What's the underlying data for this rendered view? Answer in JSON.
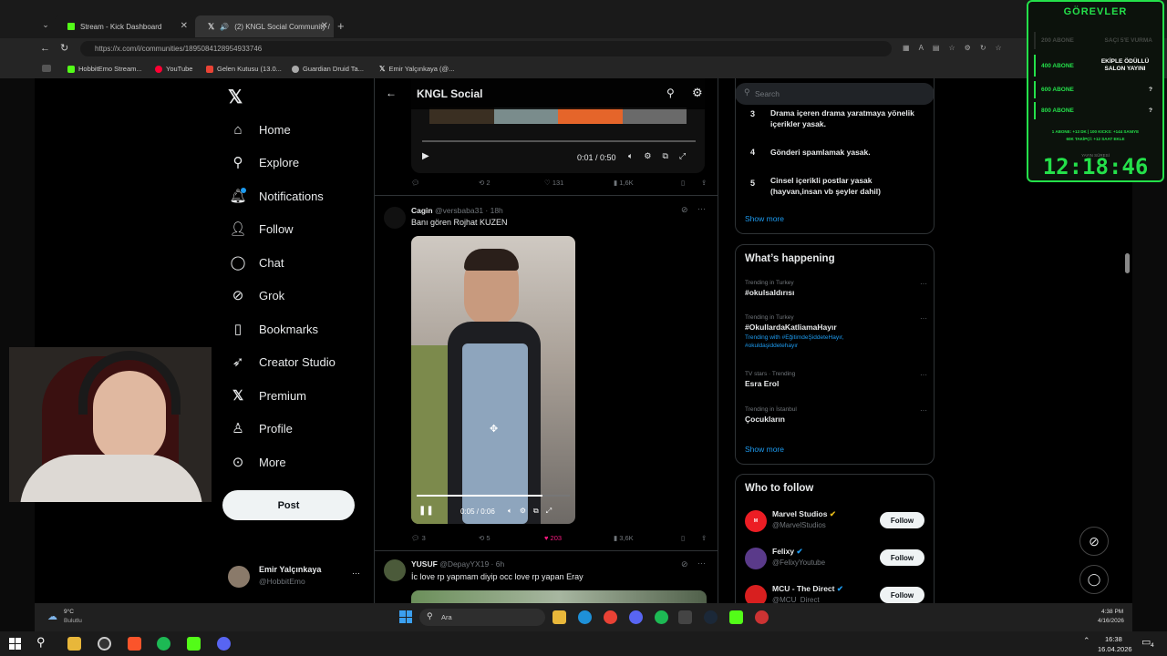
{
  "tabs": [
    {
      "label": "Stream - Kick Dashboard"
    },
    {
      "label": "(2) KNGL Social Community /"
    }
  ],
  "url": "https://x.com/i/communities/1895084128954933746",
  "bookmarks": [
    "HobbitEmo Stream...",
    "YouTube",
    "Gelen Kutusu (13.0...",
    "Guardian Druid Ta...",
    "Emir Yalçınkaya (@..."
  ],
  "nav": {
    "items": [
      "Home",
      "Explore",
      "Notifications",
      "Follow",
      "Chat",
      "Grok",
      "Bookmarks",
      "Creator Studio",
      "Premium",
      "Profile",
      "More"
    ],
    "post_label": "Post",
    "account_name": "Emir Yalçınkaya",
    "account_handle": "@HobbitEmo"
  },
  "header": {
    "title": "KNGL Social"
  },
  "video1": {
    "time": "0:01 / 0:50",
    "reposts": "2",
    "likes": "131",
    "views": "1,6K"
  },
  "post2": {
    "name": "Cagin",
    "handle": "@versbaba31 · 18h",
    "text": "Banı gören Rojhat KUZEN",
    "time": "0:05 / 0:06",
    "replies": "3",
    "reposts": "5",
    "likes": "203",
    "views": "3,6K"
  },
  "post3": {
    "name": "YUSUF",
    "handle": "@DepayYX19 · 6h",
    "text": "İc love rp yapmam diyip occ love rp yapan Eray"
  },
  "search": {
    "placeholder": "Search"
  },
  "rules": [
    {
      "num": "3",
      "text": "Drama içeren drama yaratmaya yönelik içerikler yasak."
    },
    {
      "num": "4",
      "text": "Gönderi spamlamak yasak."
    },
    {
      "num": "5",
      "text": "Cinsel içerikli postlar yasak (hayvan,insan vb şeyler dahil)"
    }
  ],
  "show_more": "Show more",
  "happening": {
    "title": "What’s happening",
    "trends": [
      {
        "meta": "Trending in Turkey",
        "name": "#okulsaldırısı",
        "extra": ""
      },
      {
        "meta": "Trending in Turkey",
        "name": "#OkullardaKatliamaHayır",
        "extra": "Trending with #EğitimdeŞiddeteHayır, #okuldaşiddetehayır"
      },
      {
        "meta": "TV stars · Trending",
        "name": "Esra Erol",
        "extra": ""
      },
      {
        "meta": "Trending in İstanbul",
        "name": "Çocukların",
        "extra": ""
      }
    ]
  },
  "who_to_follow": {
    "title": "Who to follow",
    "follow_label": "Follow",
    "accounts": [
      {
        "name": "Marvel Studios",
        "handle": "@MarvelStudios"
      },
      {
        "name": "Felixy",
        "handle": "@FelixyYoutube"
      },
      {
        "name": "MCU - The Direct",
        "handle": "@MCU_Direct"
      }
    ]
  },
  "gorevler": {
    "title": "GÖREVLER",
    "rows": [
      {
        "left": "200 ABONE",
        "right": "SAÇI 5'E VURMA"
      },
      {
        "left": "400 ABONE",
        "right": "EKİPLE ÖDÜLLÜ SALON YAYINI"
      },
      {
        "left": "600 ABONE",
        "right": "?"
      },
      {
        "left": "800 ABONE",
        "right": "?"
      }
    ],
    "info1": "1 ABONE: +13 DK | 100 KICKS: +144 SANIYE",
    "info2": "60K TAKİPÇİ: +12 SAAT EKLE",
    "timer": "12:18:46",
    "timer_label": "YAYIN SÜRESİ"
  },
  "taskbar": {
    "weather_temp": "9°C",
    "weather_desc": "Bulutlu",
    "search": "Ara",
    "clock_inner": "4:38 PM",
    "date_inner": "4/16/2026",
    "clock": "16:38",
    "date": "16.04.2026",
    "notif_count": "4"
  }
}
